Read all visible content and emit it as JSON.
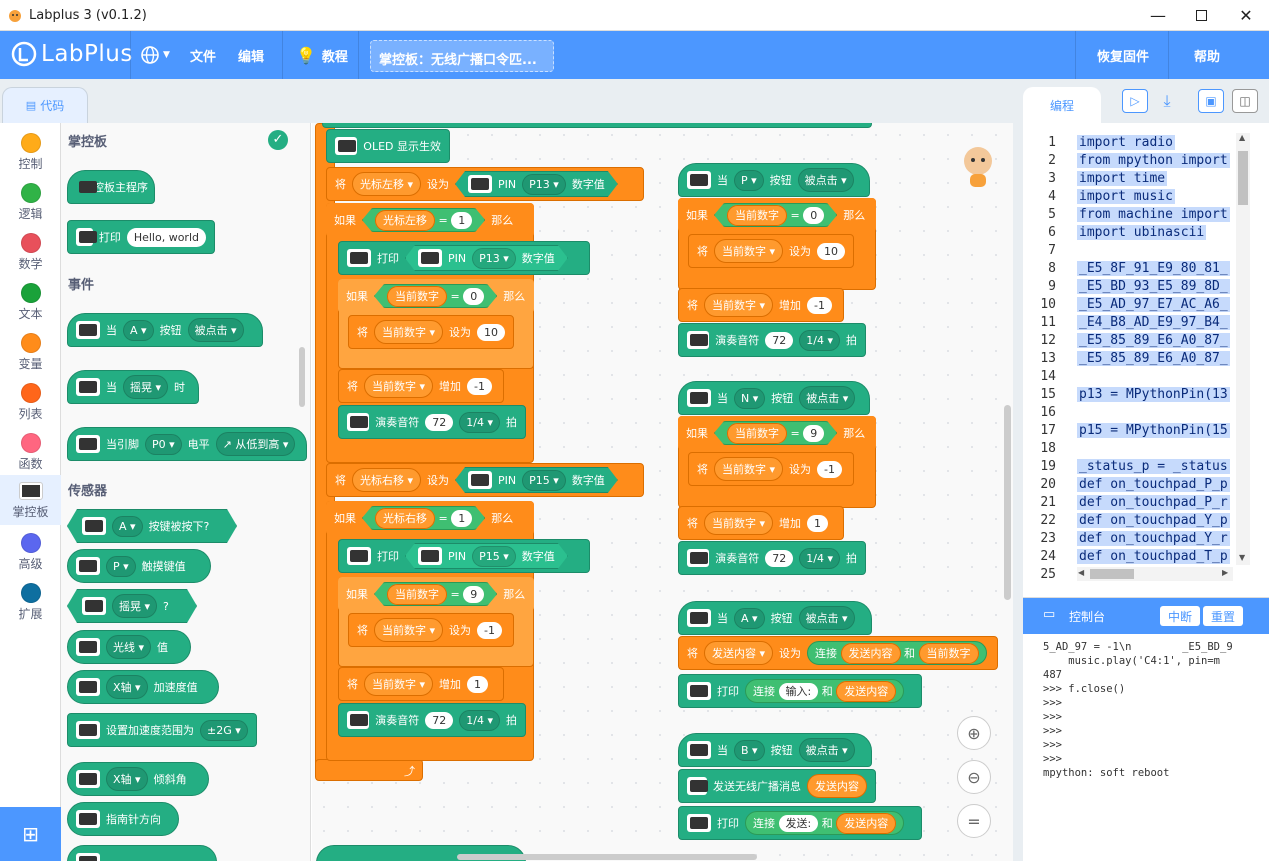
{
  "window": {
    "title": "Labplus 3 (v0.1.2)",
    "min": "—",
    "max": "☐",
    "close": "✕"
  },
  "menu": {
    "logo": "LabPlus",
    "lang_icon": "globe-icon",
    "file": "文件",
    "edit": "编辑",
    "tutorial": "教程",
    "project": "掌控板：无线广播口令匹...",
    "restore": "恢复固件",
    "help": "帮助"
  },
  "tabs": {
    "code": "代码",
    "program": "编程"
  },
  "categories": [
    {
      "label": "控制",
      "color": "#ffab19"
    },
    {
      "label": "逻辑",
      "color": "#30b347"
    },
    {
      "label": "数学",
      "color": "#e8505b"
    },
    {
      "label": "文本",
      "color": "#29a329"
    },
    {
      "label": "变量",
      "color": "#ff8c1a"
    },
    {
      "label": "列表",
      "color": "#ff661a"
    },
    {
      "label": "函数",
      "color": "#ff6680"
    },
    {
      "label": "掌控板",
      "color": "#ffffff"
    },
    {
      "label": "高级",
      "color": "#5b67ef"
    },
    {
      "label": "扩展",
      "color": "#0e6fa0"
    }
  ],
  "flyout": {
    "h_board": "掌控板",
    "h_events": "事件",
    "h_sensors": "传感器",
    "main": "掌控板主程序",
    "print": "打印",
    "hello": "Hello, world",
    "when": "当",
    "A": "A",
    "button": "按钮",
    "clicked": "被点击",
    "shake": "摇晃",
    "time": "时",
    "pin_when": "当引脚",
    "P0": "P0",
    "level": "电平",
    "rise": "↗ 从低到高",
    "btn_pressed": "按键被按下?",
    "P": "P",
    "touch": "触摸键值",
    "shaken": "摇晃",
    "q": "?",
    "light": "光线",
    "value": "值",
    "x_axis": "X轴",
    "accel": "加速度值",
    "set_range": "设置加速度范围为",
    "range": "±2G",
    "tilt": "倾斜角",
    "compass": "指南针方向"
  },
  "ws": {
    "oled": "OLED 显示生效",
    "set": "将",
    "to": "设为",
    "if": "如果",
    "then": "那么",
    "eq": "=",
    "print": "打印",
    "cur_left": "光标左移",
    "cur_right": "光标右移",
    "pin": "PIN",
    "P13": "P13",
    "P15": "P15",
    "digital": "数字值",
    "cur_num": "当前数字",
    "v0": "0",
    "v1": "1",
    "v9": "9",
    "v10": "10",
    "vm1": "-1",
    "inc": "增加",
    "play": "演奏音符",
    "n72": "72",
    "quarter": "1/4",
    "beat": "拍",
    "when": "当",
    "P": "P",
    "N": "N",
    "A": "A",
    "B": "B",
    "button": "按钮",
    "clicked": "被点击",
    "send_content": "发送内容",
    "concat": "连接",
    "and": "和",
    "input": "输入:",
    "send": "发送:",
    "send_radio": "发送无线广播消息"
  },
  "code_lines": [
    {
      "n": "1",
      "t": "import radio"
    },
    {
      "n": "2",
      "t": "from mpython import"
    },
    {
      "n": "3",
      "t": "import time"
    },
    {
      "n": "4",
      "t": "import music"
    },
    {
      "n": "5",
      "t": "from machine import"
    },
    {
      "n": "6",
      "t": "import ubinascii"
    },
    {
      "n": "7",
      "t": ""
    },
    {
      "n": "8",
      "t": "_E5_8F_91_E9_80_81_"
    },
    {
      "n": "9",
      "t": "_E5_BD_93_E5_89_8D_"
    },
    {
      "n": "10",
      "t": "_E5_AD_97_E7_AC_A6_"
    },
    {
      "n": "11",
      "t": "_E4_B8_AD_E9_97_B4_"
    },
    {
      "n": "12",
      "t": "_E5_85_89_E6_A0_87_"
    },
    {
      "n": "13",
      "t": "_E5_85_89_E6_A0_87_"
    },
    {
      "n": "14",
      "t": ""
    },
    {
      "n": "15",
      "t": "p13 = MPythonPin(13"
    },
    {
      "n": "16",
      "t": ""
    },
    {
      "n": "17",
      "t": "p15 = MPythonPin(15"
    },
    {
      "n": "18",
      "t": ""
    },
    {
      "n": "19",
      "t": "_status_p = _status"
    },
    {
      "n": "20",
      "t": "def on_touchpad_P_p"
    },
    {
      "n": "21",
      "t": "def on_touchpad_P_r"
    },
    {
      "n": "22",
      "t": "def on_touchpad_Y_p"
    },
    {
      "n": "23",
      "t": "def on_touchpad_Y_r"
    },
    {
      "n": "24",
      "t": "def on_touchpad_T_p"
    },
    {
      "n": "25",
      "t": ""
    }
  ],
  "console": {
    "title": "控制台",
    "interrupt": "中断",
    "reset": "重置",
    "lines": "5_AD_97 = -1\\n        _E5_BD_9\n    music.play('C4:1', pin=m\n487\n>>> f.close()\n>>>\n>>>\n>>>\n>>>\n>>>\nmpython: soft reboot"
  }
}
